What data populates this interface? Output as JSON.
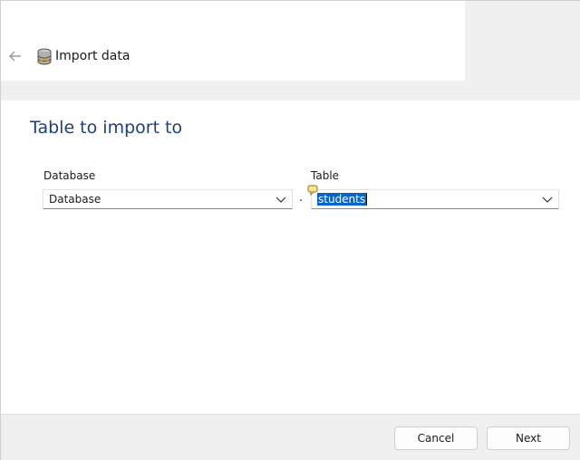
{
  "window": {
    "title": "Import data"
  },
  "page": {
    "heading": "Table to import to"
  },
  "database": {
    "label": "Database",
    "value": "Database"
  },
  "separator": ".",
  "table": {
    "label": "Table",
    "value": "students"
  },
  "footer": {
    "cancel_label": "Cancel",
    "next_label": "Next"
  },
  "colors": {
    "heading": "#1f3f7a",
    "selection": "#0a64c8"
  }
}
